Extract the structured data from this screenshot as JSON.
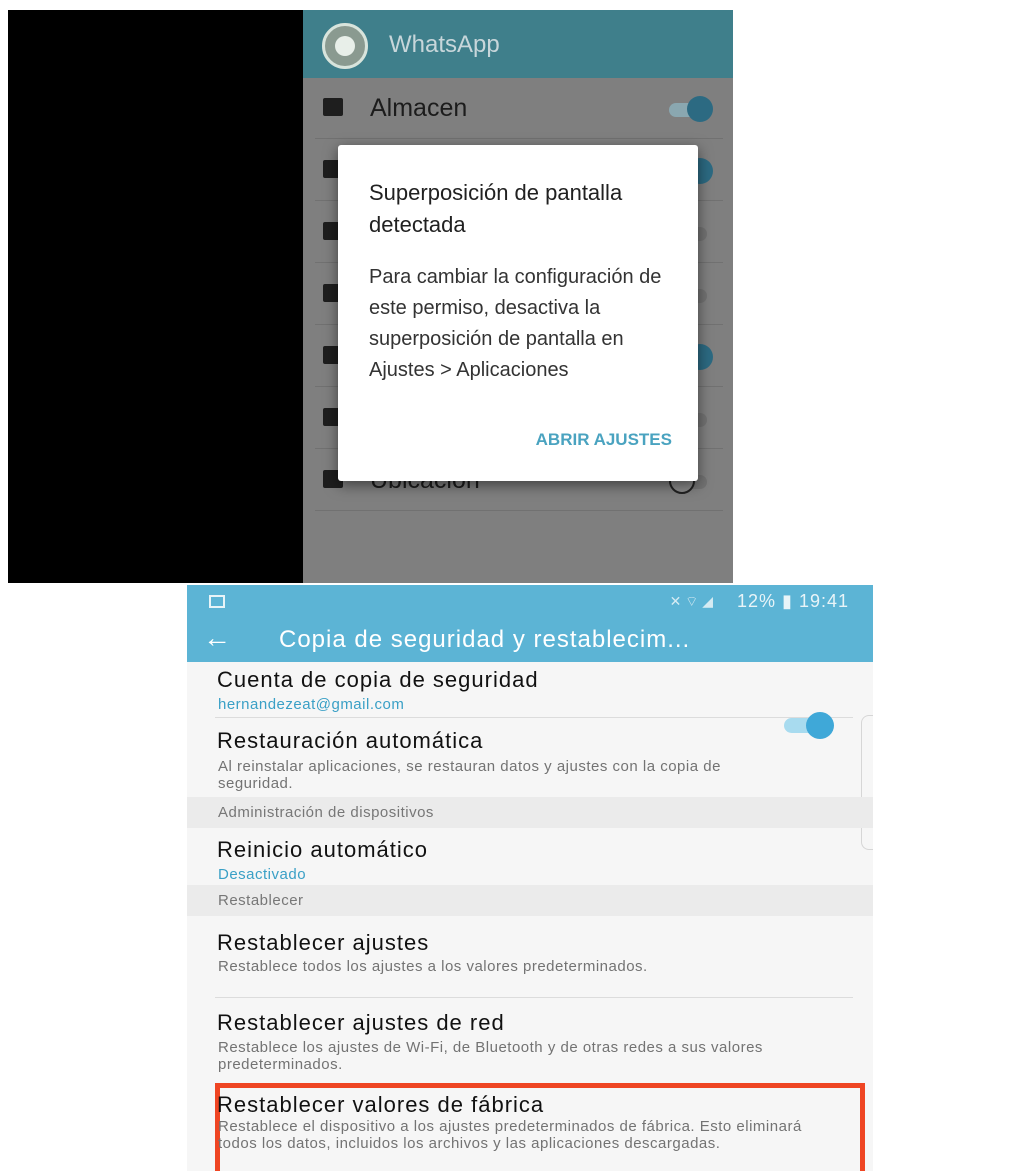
{
  "whatsapp": {
    "title": "WhatsApp",
    "permissions": [
      {
        "label": "Almacen",
        "enabled": true
      },
      {
        "label": "",
        "enabled": true
      },
      {
        "label": "",
        "enabled": false
      },
      {
        "label": "",
        "enabled": false
      },
      {
        "label": "",
        "enabled": true
      },
      {
        "label": "",
        "enabled": false
      },
      {
        "label": "Ubicación",
        "enabled": false
      }
    ],
    "dialog": {
      "title": "Superposición de pantalla detectada",
      "body": "Para cambiar la configuración de este permiso, desactiva la superposición de pantalla en Ajustes > Aplicaciones",
      "action": "ABRIR AJUSTES"
    }
  },
  "settings": {
    "status_bar": {
      "battery": "12%",
      "time": "19:41",
      "display": "12% ▮ 19:41"
    },
    "app_bar": {
      "title": "Copia de seguridad y restablecim...",
      "back_icon": "arrow-left-icon"
    },
    "backup_account": {
      "title": "Cuenta de copia de seguridad",
      "value": "hernandezeat@gmail.com"
    },
    "auto_restore": {
      "title": "Restauración automática",
      "description": "Al reinstalar aplicaciones, se restauran datos y ajustes con la copia de seguridad.",
      "enabled": true
    },
    "section_devices": "Administración de dispositivos",
    "auto_restart": {
      "title": "Reinicio automático",
      "value": "Desactivado"
    },
    "section_reset": "Restablecer",
    "reset_settings": {
      "title": "Restablecer ajustes",
      "description": "Restablece todos los ajustes a los valores predeterminados."
    },
    "reset_network": {
      "title": "Restablecer ajustes de red",
      "description": "Restablece los ajustes de Wi-Fi, de Bluetooth y de otras redes a sus valores predeterminados."
    },
    "factory_reset": {
      "title": "Restablecer valores de fábrica",
      "description": "Restablece el dispositivo a los ajustes predeterminados de fábrica. Esto eliminará todos los datos, incluidos los archivos y las aplicaciones descargadas."
    },
    "highlight_color": "#ef4523",
    "accent_color": "#5cb4d5"
  }
}
